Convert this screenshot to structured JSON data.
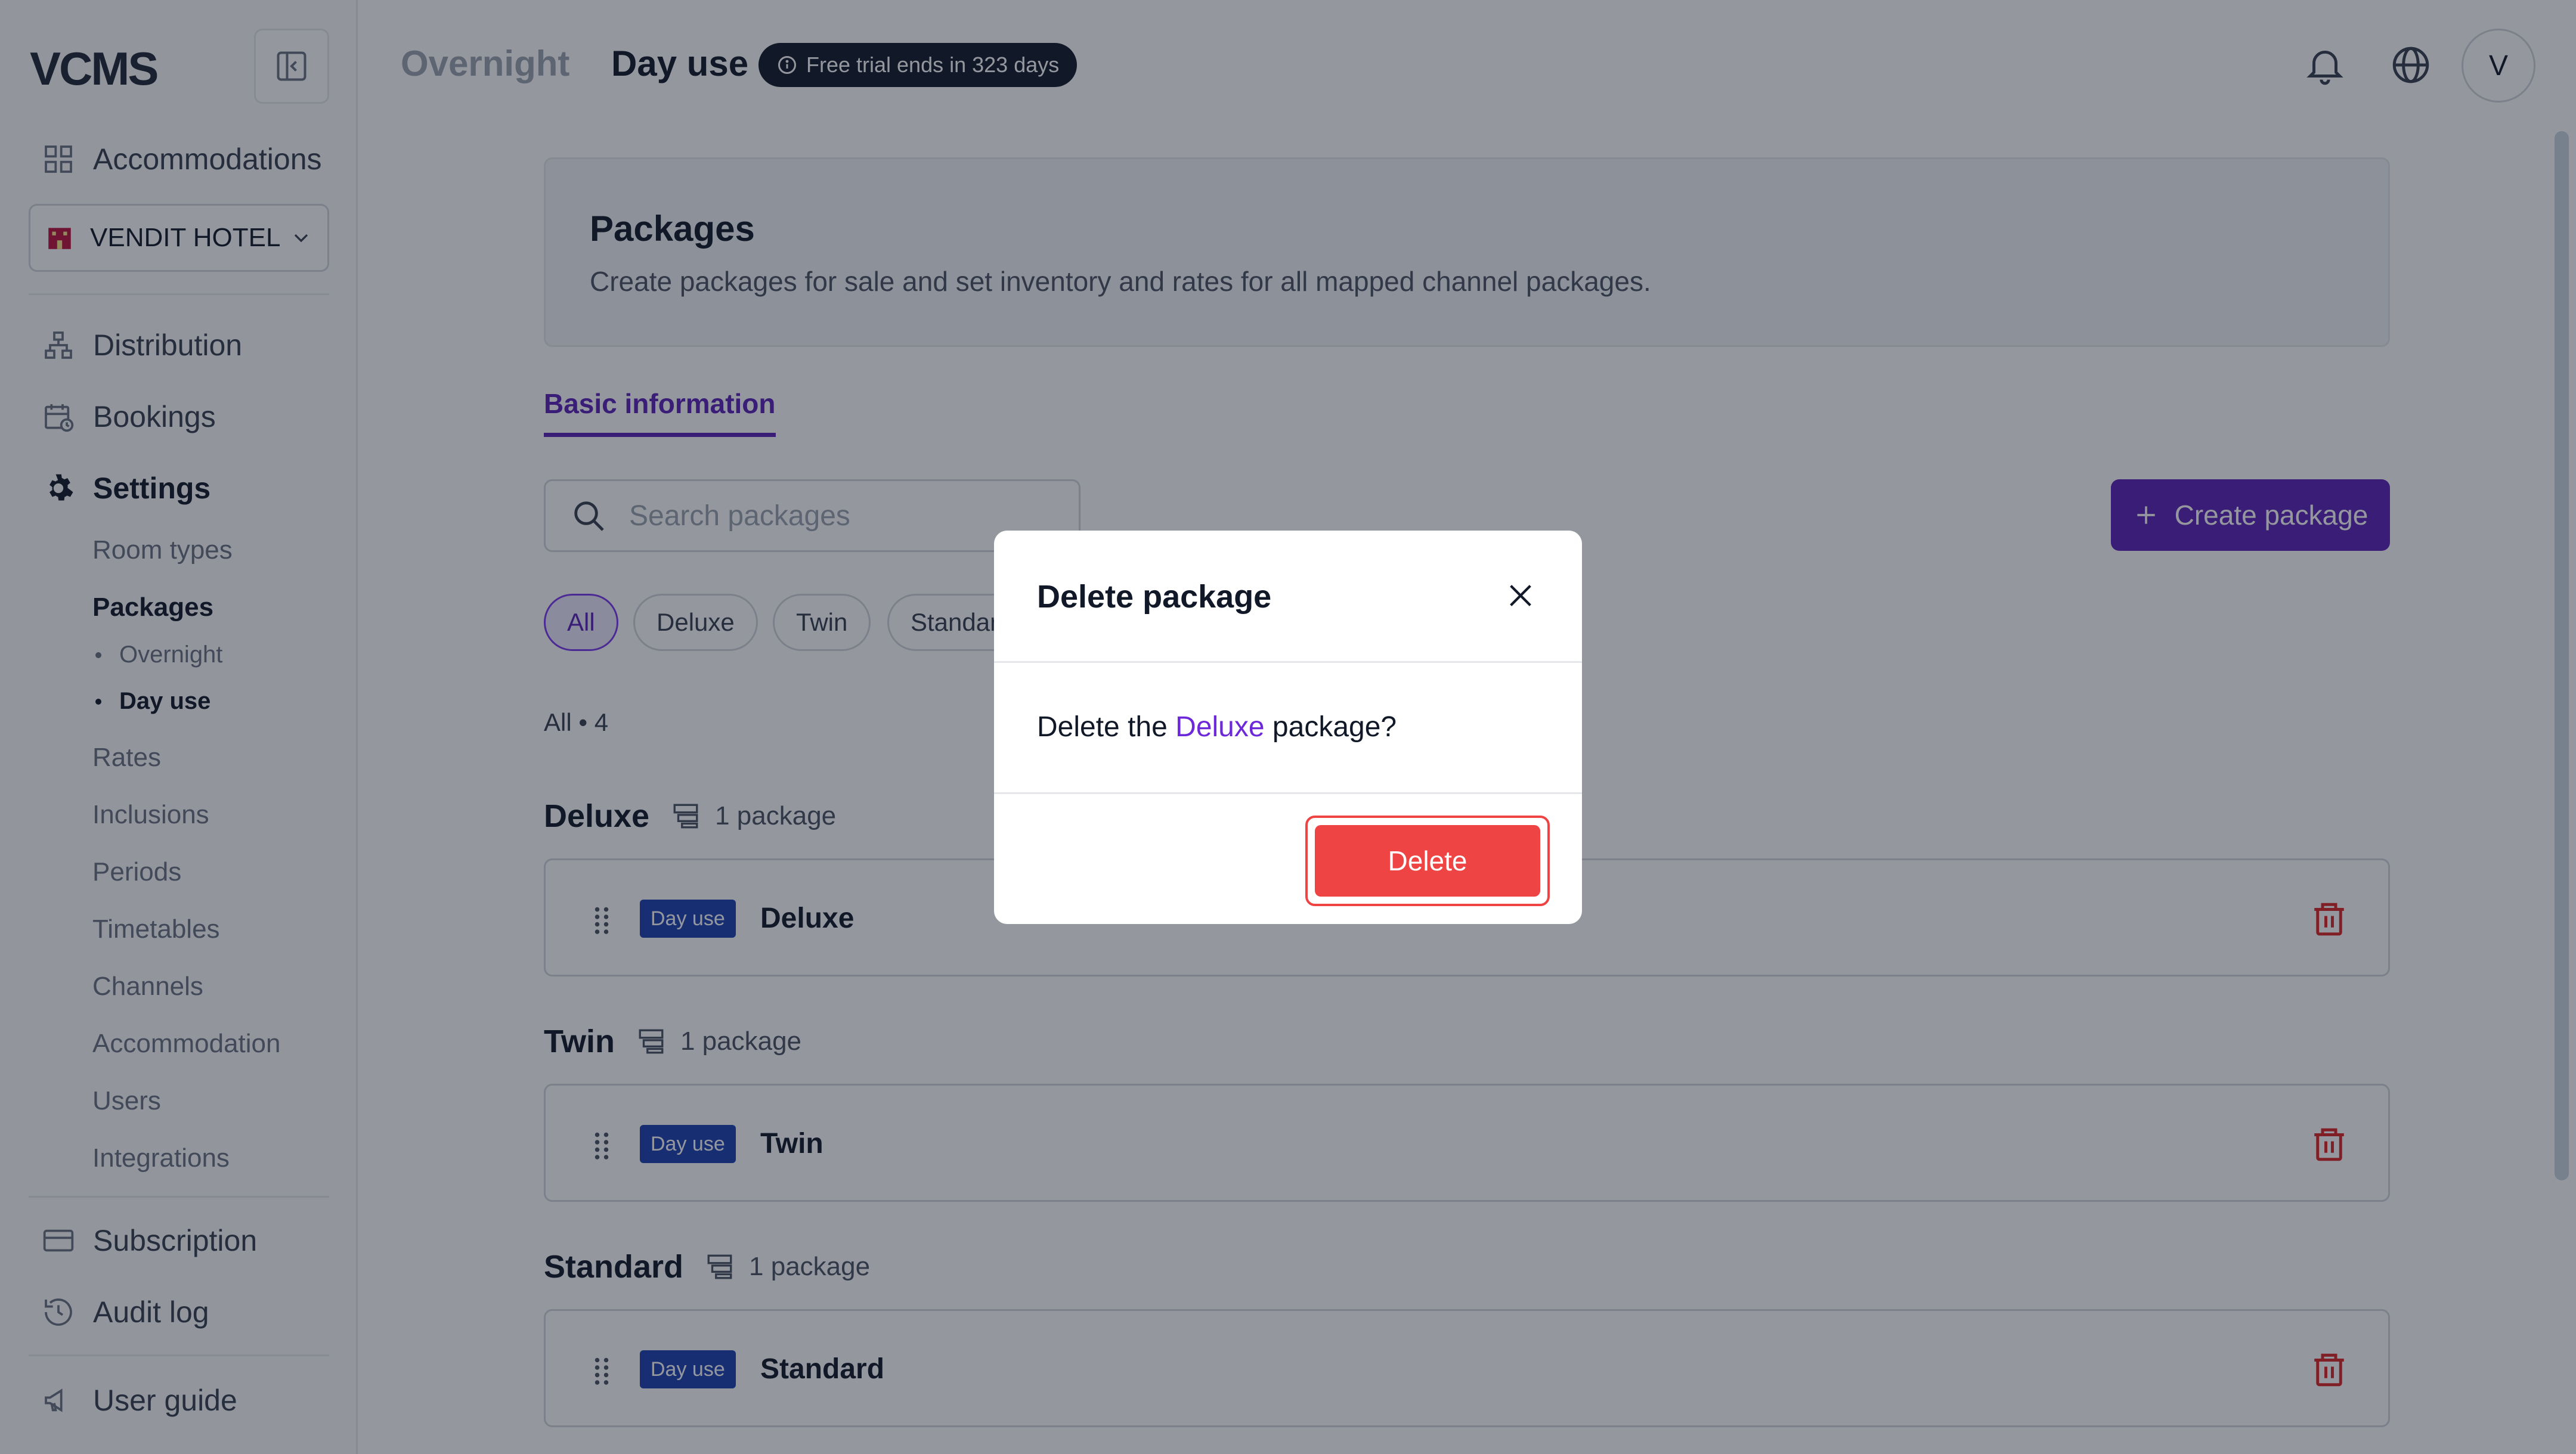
{
  "sidebar": {
    "logo": "VCMS",
    "accommodations_label": "Accommodations",
    "hotel_name": "VENDIT HOTEL",
    "nav": {
      "distribution": "Distribution",
      "bookings": "Bookings",
      "settings": "Settings",
      "subscription": "Subscription",
      "audit_log": "Audit log",
      "user_guide": "User guide"
    },
    "settings_items": {
      "room_types": "Room types",
      "packages": "Packages",
      "overnight": "Overnight",
      "day_use": "Day use",
      "rates": "Rates",
      "inclusions": "Inclusions",
      "periods": "Periods",
      "timetables": "Timetables",
      "channels": "Channels",
      "accommodation": "Accommodation",
      "users": "Users",
      "integrations": "Integrations"
    }
  },
  "header": {
    "tab_overnight": "Overnight",
    "tab_day_use": "Day use",
    "trial_badge": "Free trial ends in 323 days",
    "avatar_initial": "V"
  },
  "main": {
    "card_title": "Packages",
    "card_desc": "Create packages for sale and set inventory and rates for all mapped channel packages.",
    "tab_basic": "Basic information",
    "search_placeholder": "Search packages",
    "create_button": "Create package",
    "chips": {
      "all": "All",
      "deluxe": "Deluxe",
      "twin": "Twin",
      "standard": "Standard"
    },
    "count_label": "All",
    "count_value": "4",
    "groups": [
      {
        "title": "Deluxe",
        "count": "1 package",
        "tag": "Day use",
        "name": "Deluxe"
      },
      {
        "title": "Twin",
        "count": "1 package",
        "tag": "Day use",
        "name": "Twin"
      },
      {
        "title": "Standard",
        "count": "1 package",
        "tag": "Day use",
        "name": "Standard"
      }
    ]
  },
  "modal": {
    "title": "Delete package",
    "text_prefix": "Delete the",
    "text_highlight": "Deluxe",
    "text_suffix": "package?",
    "delete_button": "Delete"
  },
  "colors": {
    "accent": "#5b21b6",
    "danger": "#ef4444",
    "tag_blue": "#1e40af"
  }
}
